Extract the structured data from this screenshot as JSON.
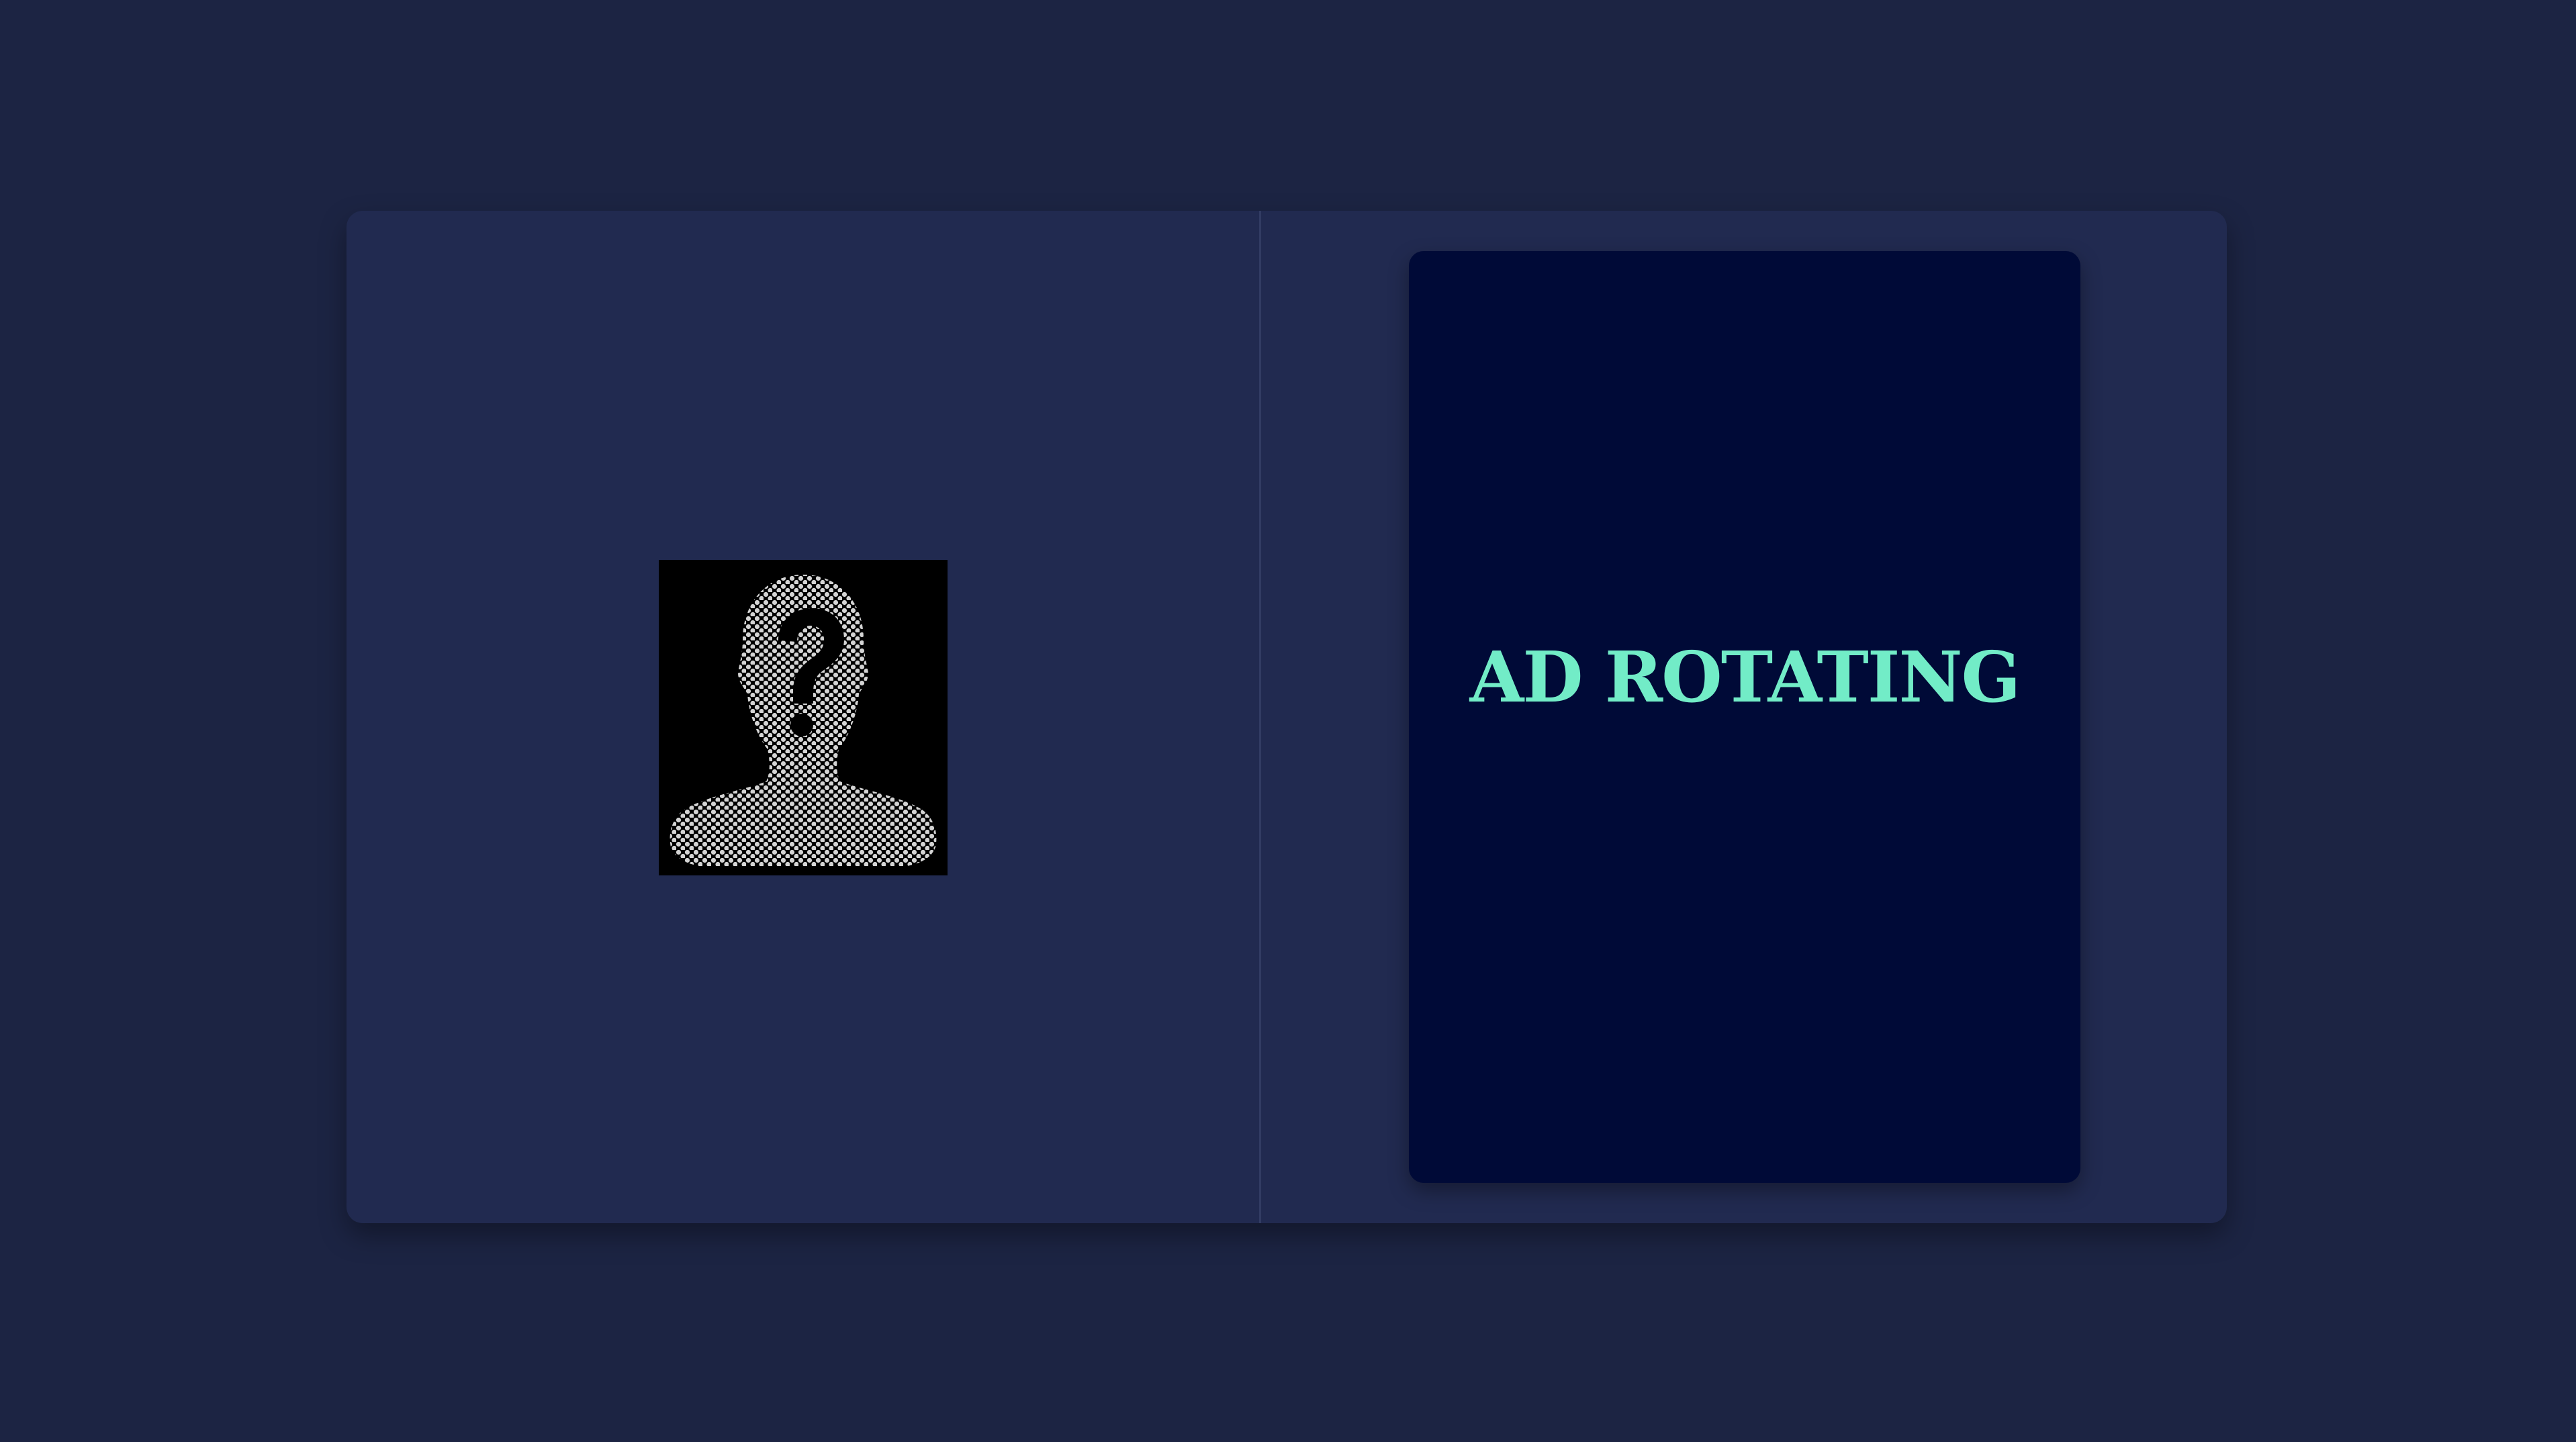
{
  "page": {
    "background": "#1c2443"
  },
  "card": {
    "background": "#212a50"
  },
  "profile": {
    "avatar_icon": "unknown-person-question-mark-icon"
  },
  "ad": {
    "text": "AD ROTATING",
    "text_color": "#72ecc7",
    "background": "#000a37"
  }
}
